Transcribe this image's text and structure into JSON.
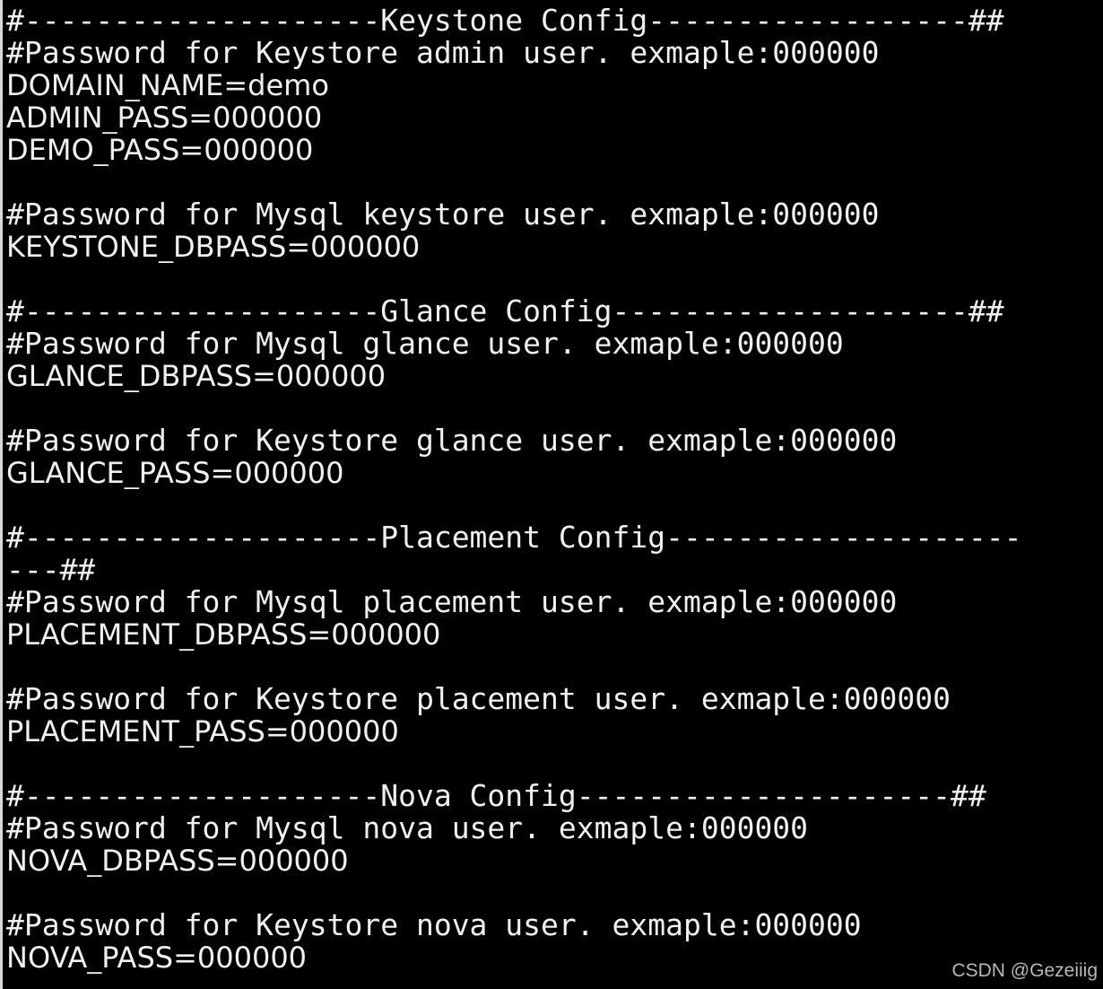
{
  "colors": {
    "background": "#000000",
    "text": "#f0f0f0",
    "watermark": "#b8b8b8"
  },
  "lines": [
    "#--------------------Keystone Config------------------##",
    "#Password for Keystore admin user. exmaple:000000",
    "DOMAIN_NAME=demo",
    "ADMIN_PASS=000000",
    "DEMO_PASS=000000",
    "#Password for Mysql keystore user. exmaple:000000",
    "KEYSTONE_DBPASS=000000",
    "#--------------------Glance Config--------------------##",
    "#Password for Mysql glance user. exmaple:000000",
    "GLANCE_DBPASS=000000",
    "#Password for Keystore glance user. exmaple:000000",
    "GLANCE_PASS=000000",
    "#--------------------Placement Config--------------------",
    "---##",
    "#Password for Mysql placement user. exmaple:000000",
    "PLACEMENT_DBPASS=000000",
    "#Password for Keystore placement user. exmaple:000000",
    "PLACEMENT_PASS=000000",
    "#--------------------Nova Config---------------------##",
    "#Password for Mysql nova user. exmaple:000000",
    "NOVA_DBPASS=000000",
    "#Password for Keystore nova user. exmaple:000000",
    "NOVA_PASS=000000"
  ],
  "watermark": "CSDN @Gezeiiig"
}
